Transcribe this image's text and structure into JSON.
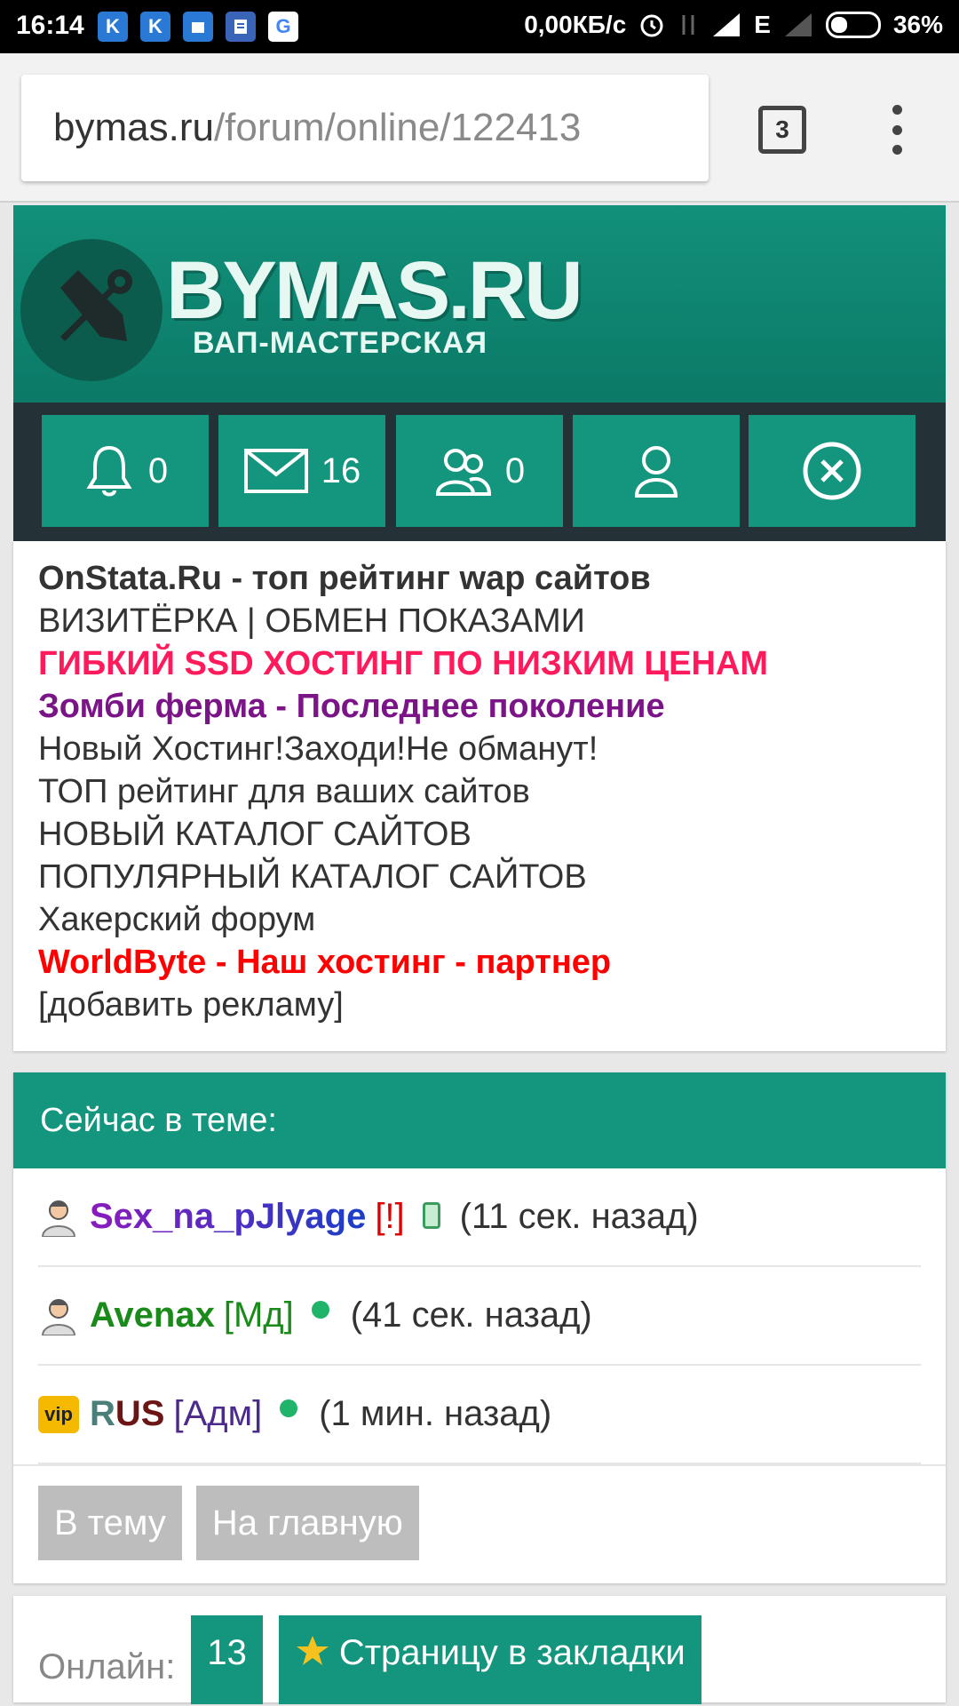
{
  "status_bar": {
    "time": "16:14",
    "app_icons": [
      {
        "letter": "K",
        "color": "#2a7ad5"
      },
      {
        "letter": "K",
        "color": "#2a7ad5"
      },
      {
        "letter": "",
        "color": "#2a7ad5"
      },
      {
        "letter": "",
        "color": "#3a64b8"
      },
      {
        "letter": "G",
        "color": "#ffffff"
      }
    ],
    "network_speed": "0,00КБ/с",
    "network_type": "E",
    "battery": "36%",
    "battery_level": 0.36
  },
  "browser": {
    "url_host": "bymas.ru",
    "url_path": "/forum/online/122413",
    "tab_count": "3"
  },
  "banner": {
    "title": "BYMAS.RU",
    "subtitle": "ВАП-МАСТЕРСКАЯ"
  },
  "icon_bar": {
    "notifications": "0",
    "messages": "16",
    "friends": "0"
  },
  "ads": [
    {
      "text": "OnStata.Ru - топ рейтинг wap сайтов",
      "color": "#333333",
      "bold": true
    },
    {
      "text": "ВИЗИТЁРКА | ОБМЕН ПОКАЗАМИ",
      "color": "#333333",
      "bold": false
    },
    {
      "text": "ГИБКИЙ SSD ХОСТИНГ ПО НИЗКИМ ЦЕНАМ",
      "color": "#ff1a5b",
      "bold": true
    },
    {
      "text": "Зомби ферма - Последнее поколение",
      "color": "#7a1487",
      "bold": true
    },
    {
      "text": "Новый Хостинг!Заходи!Не обманут!",
      "color": "#333333",
      "bold": false
    },
    {
      "text": "ТОП рейтинг для ваших сайтов",
      "color": "#333333",
      "bold": false
    },
    {
      "text": "НОВЫЙ КАТАЛОГ САЙТОВ",
      "color": "#333333",
      "bold": false
    },
    {
      "text": "ПОПУЛЯРНЫЙ КАТАЛОГ САЙТОВ",
      "color": "#333333",
      "bold": false
    },
    {
      "text": "Хакерский форум",
      "color": "#333333",
      "bold": false
    },
    {
      "text": "WorldByte - Наш хостинг - партнер",
      "color": "#ff0000",
      "bold": true
    },
    {
      "text": "[добавить рекламу]",
      "color": "#333333",
      "bold": false
    }
  ],
  "online": {
    "heading": "Сейчас в теме:",
    "users": [
      {
        "nick": "Sex_na_pJlyage",
        "role": "[!]",
        "role_color": "#e00000",
        "status": "phone",
        "time": "(11 сек. назад)"
      },
      {
        "nick_part1": "Avenax",
        "role": "[Мд]",
        "nick_color": "#1a8a1a",
        "role_color": "#1a8a1a",
        "status": "dot",
        "time": "(41 сек. назад)"
      },
      {
        "nick_r": "R",
        "nick_us": "US",
        "role": "[Адм]",
        "nick_r_color": "#4a7f7a",
        "nick_us_color": "#6b1515",
        "role_color": "#4b2a8c",
        "status": "dot",
        "time": "(1 мин. назад)",
        "badge": "vip"
      }
    ]
  },
  "buttons": {
    "to_topic": "В тему",
    "to_main": "На главную"
  },
  "footer": {
    "online_label": "Онлайн:",
    "online_count": "13",
    "bookmark": "Страницу в закладки"
  }
}
